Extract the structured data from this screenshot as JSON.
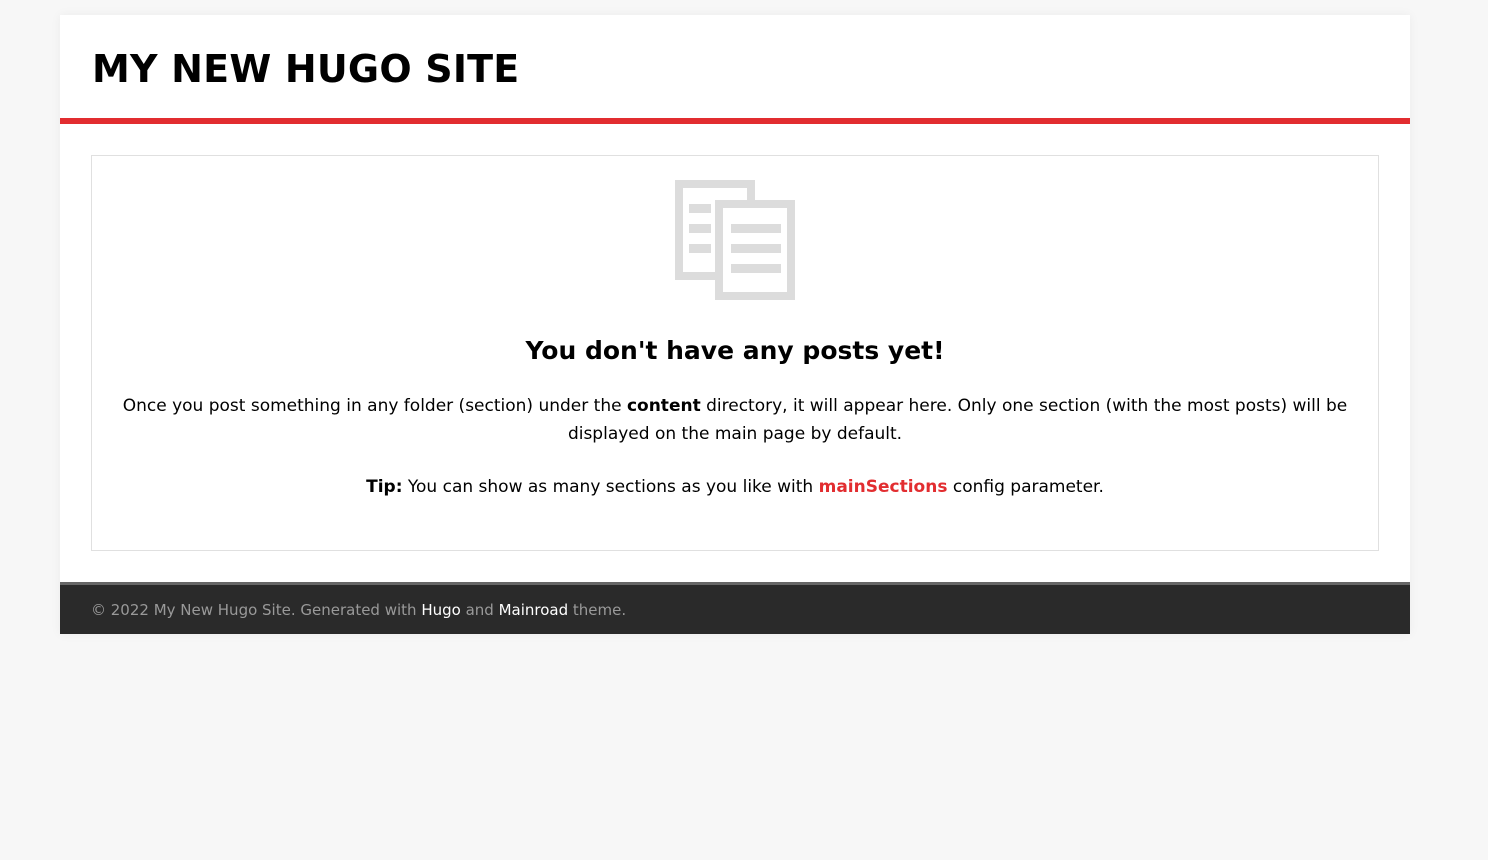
{
  "header": {
    "site_title": "MY NEW HUGO SITE"
  },
  "empty_state": {
    "icon": "documents-icon",
    "title": "You don't have any posts yet!",
    "text_before": "Once you post something in any folder (section) under the ",
    "text_bold": "content",
    "text_after": " directory, it will appear here. Only one section (with the most posts) will be displayed on the main page by default.",
    "tip_label": "Tip:",
    "tip_before": " You can show as many sections as you like with ",
    "tip_link": "mainSections",
    "tip_after": " config parameter."
  },
  "footer": {
    "prefix": "© 2022 My New Hugo Site. Generated with ",
    "hugo_link": "Hugo",
    "and_text": " and ",
    "theme_link": "Mainroad",
    "suffix": " theme."
  },
  "colors": {
    "accent": "#e22d30",
    "footer_bg": "#2a2a2a",
    "page_bg": "#f7f7f7",
    "icon_gray": "#dcdcdc"
  }
}
